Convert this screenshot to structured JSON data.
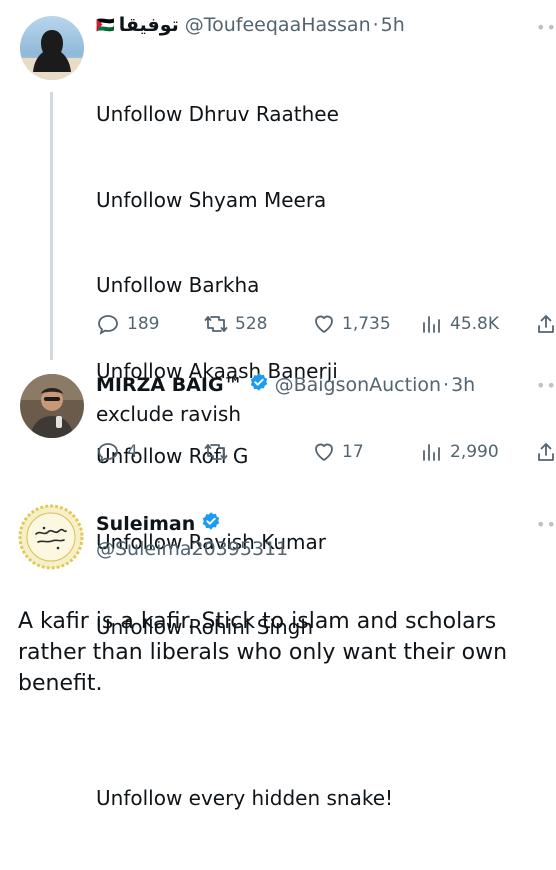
{
  "tweets": [
    {
      "display_name": "توفيقا",
      "flag": "🇵🇸",
      "handle": "@ToufeeqaaHassan",
      "separator": "·",
      "time": "5h",
      "lines": [
        "Unfollow Dhruv Raathee",
        "Unfollow Shyam Meera",
        "Unfollow Barkha",
        "Unfollow Akaash Banerji",
        "Unfollow Rofl G",
        "Unfollow Ravish Kumar",
        "Unfollow Rohini Singh",
        "",
        "Unfollow every hidden snake!"
      ],
      "stats": {
        "replies": "189",
        "retweets": "528",
        "likes": "1,735",
        "views": "45.8K"
      }
    },
    {
      "display_name": "MIRZA BAIG™",
      "verified": true,
      "handle": "@BaigsonAuction",
      "separator": "·",
      "time": "3h",
      "text": "exclude ravish",
      "stats": {
        "replies": "4",
        "retweets": "",
        "likes": "17",
        "views": "2,990"
      }
    },
    {
      "display_name": "Suleiman",
      "verified": true,
      "handle": "@Suleima20395311",
      "text_lines": [
        "A kafir is a kafir. Stick to islam and scholars",
        "rather than liberals who only want their own",
        "benefit."
      ]
    }
  ],
  "icons": {
    "reply": "reply-icon",
    "retweet": "retweet-icon",
    "like": "heart-icon",
    "views": "views-icon",
    "share": "share-icon",
    "more": "more-icon",
    "verified": "verified-badge-icon"
  },
  "colors": {
    "accent": "#1d9bf0",
    "muted": "#536471",
    "text": "#0f1419",
    "thread_line": "#cfd9de"
  }
}
